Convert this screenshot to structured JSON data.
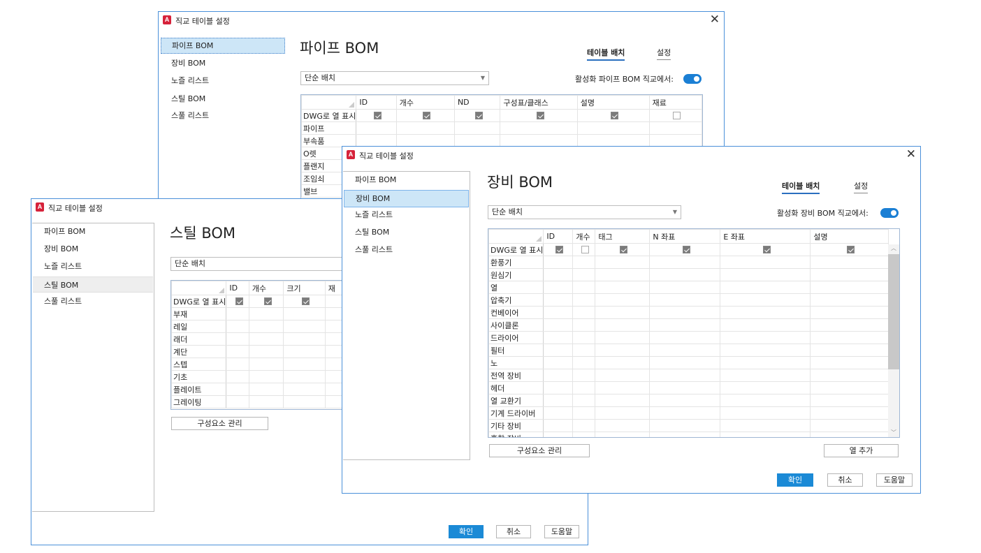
{
  "nav_items": [
    "파이프 BOM",
    "장비 BOM",
    "노즐 리스트",
    "스틸 BOM",
    "스풀 리스트"
  ],
  "common": {
    "layout_option": "단순 배치",
    "ok": "확인",
    "cancel": "취소",
    "help": "도움말",
    "manage_components": "구성요소 관리",
    "add_column": "열 추가",
    "tab_layout": "테이블 배치",
    "tab_settings": "설정",
    "show_row_label": "DWG로 열 표시",
    "app_icon_letter": "A",
    "close_glyph": "✕",
    "dropdown_glyph": "▼",
    "scroll_up_glyph": "︿",
    "scroll_down_glyph": "﹀"
  },
  "pipe": {
    "window_title": "직교 테이블 설정",
    "heading": "파이프 BOM",
    "active_label": "활성화 파이프 BOM 직교에서:",
    "columns": [
      "ID",
      "개수",
      "ND",
      "구성표/클래스",
      "설명",
      "재료"
    ],
    "checks": [
      true,
      true,
      true,
      true,
      true,
      false
    ],
    "rows": [
      "파이프",
      "부속품",
      "O렛",
      "플랜지",
      "조임쇠",
      "밸브"
    ]
  },
  "steel": {
    "window_title": "직교 테이블 설정",
    "heading": "스틸 BOM",
    "columns": [
      "ID",
      "개수",
      "크기",
      "재"
    ],
    "checks": [
      true,
      true,
      true
    ],
    "rows": [
      "부재",
      "레일",
      "래더",
      "계단",
      "스텝",
      "기초",
      "플레이트",
      "그레이팅"
    ]
  },
  "equip": {
    "window_title": "직교 테이블 설정",
    "heading": "장비 BOM",
    "active_label": "활성화 장비 BOM 직교에서:",
    "columns": [
      "ID",
      "개수",
      "태그",
      "N 좌표",
      "E 좌표",
      "설명"
    ],
    "checks": [
      true,
      false,
      true,
      true,
      true,
      true
    ],
    "rows": [
      "환풍기",
      "원심기",
      "열",
      "압축기",
      "컨베이어",
      "사이클론",
      "드라이어",
      "필터",
      "노",
      "전역 장비",
      "헤더",
      "열 교환기",
      "기계 드라이버",
      "기타 장비",
      "혼합 장비"
    ]
  },
  "colors": {
    "accent": "#1b8ad6",
    "dialog_border": "#4a90d9",
    "nav_selected": "#cde6f7",
    "toggle_on": "#1b7fd4",
    "app_icon": "#d6223a"
  }
}
